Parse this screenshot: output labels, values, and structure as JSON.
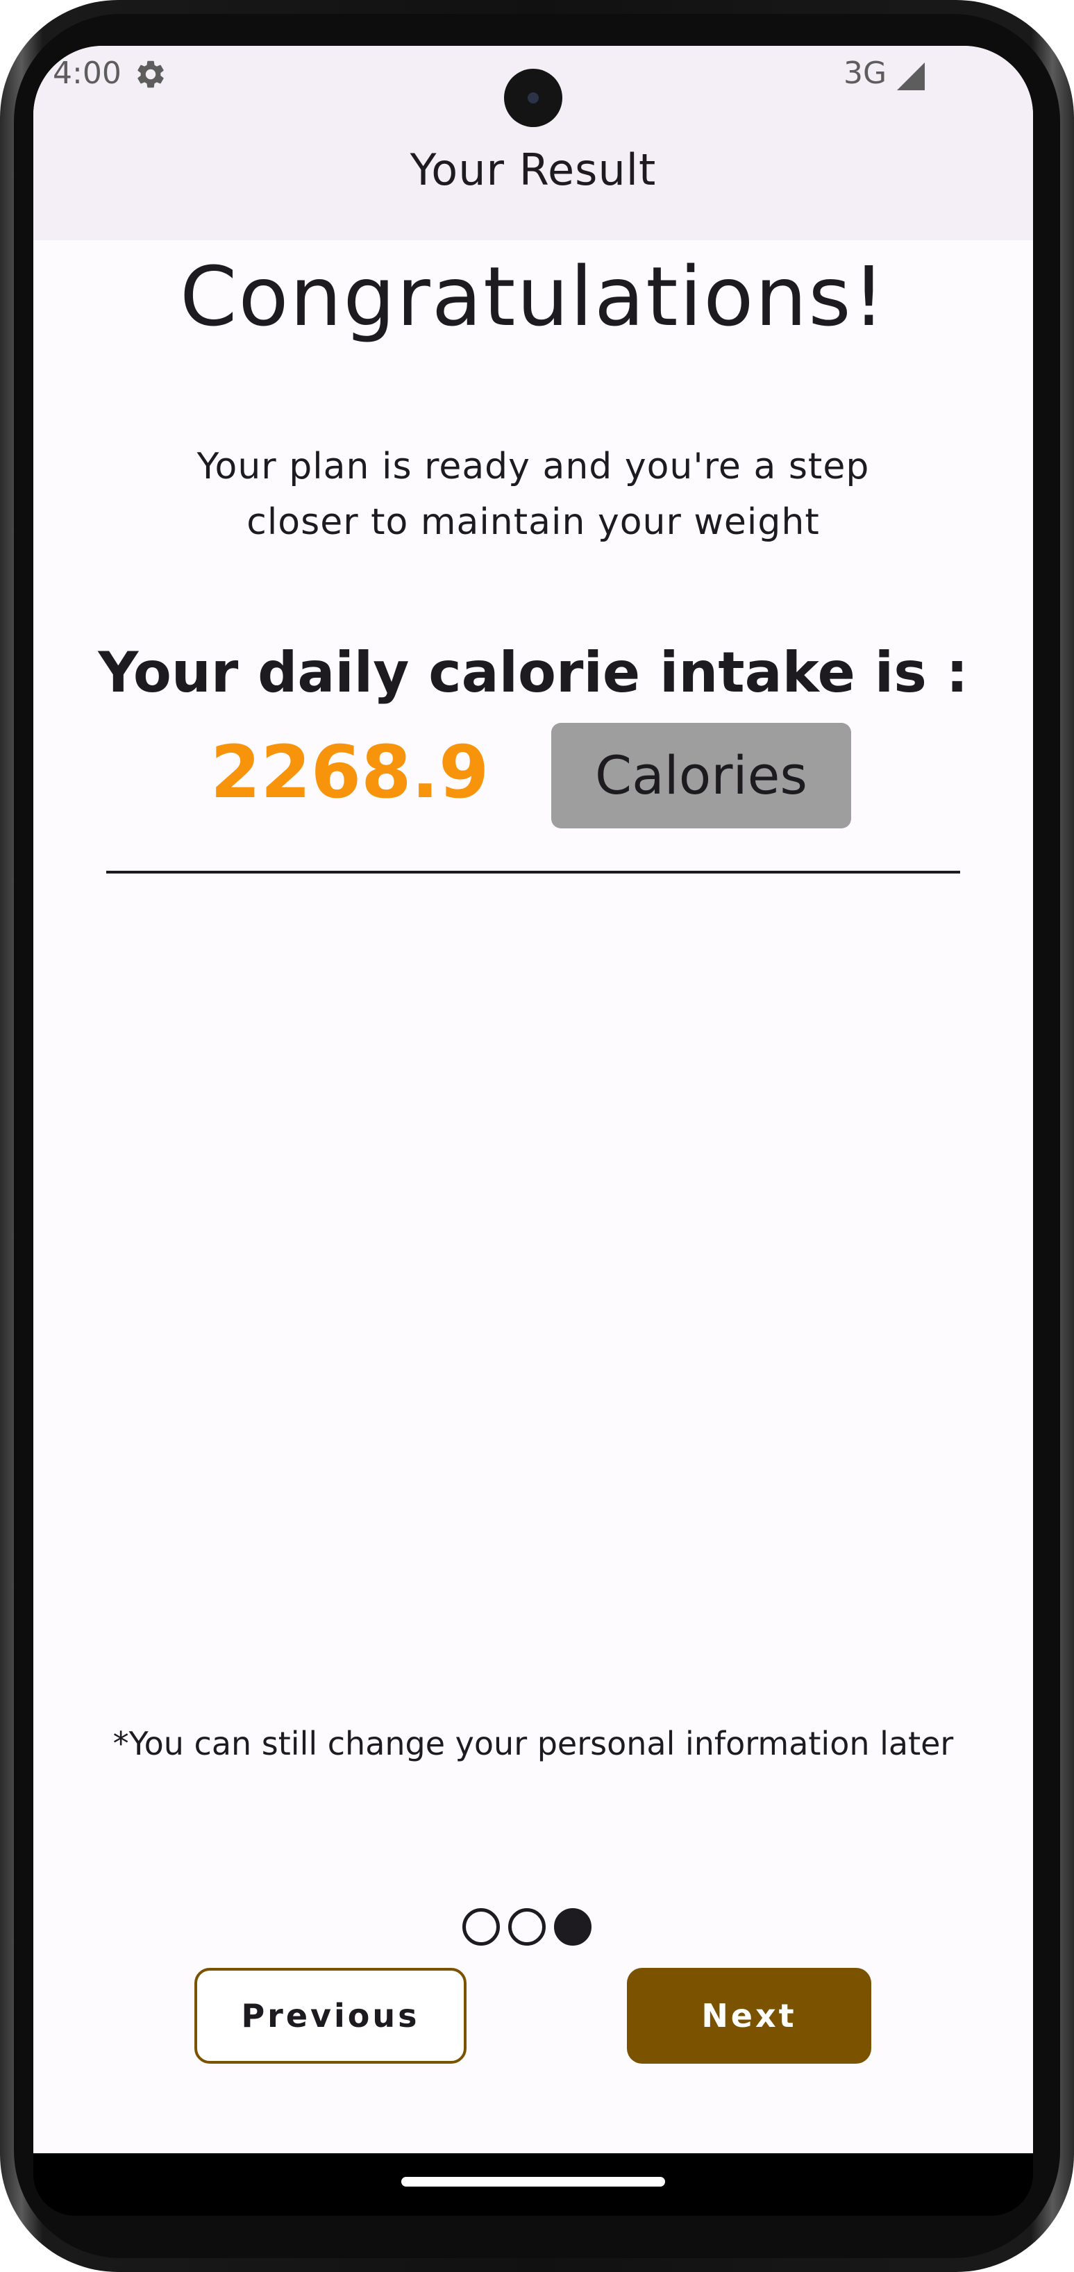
{
  "status_bar": {
    "time": "4:00",
    "network": "3G",
    "icons": [
      "gear-icon",
      "signal-icon"
    ]
  },
  "header": {
    "title": "Your Result"
  },
  "main": {
    "heading": "Congratulations!",
    "subtitle": "Your plan is ready and you're a step closer to maintain your weight",
    "intake_label": "Your daily calorie intake is :",
    "calorie_value": "2268.9",
    "calorie_unit": "Calories",
    "footnote": "*You can still change your personal information later"
  },
  "pager": {
    "total": 3,
    "current": 3
  },
  "buttons": {
    "previous": "Previous",
    "next": "Next"
  },
  "colors": {
    "accent": "#7a5200",
    "value": "#f7940c",
    "appbar": "#f4eff6",
    "badge": "#9e9e9e"
  }
}
